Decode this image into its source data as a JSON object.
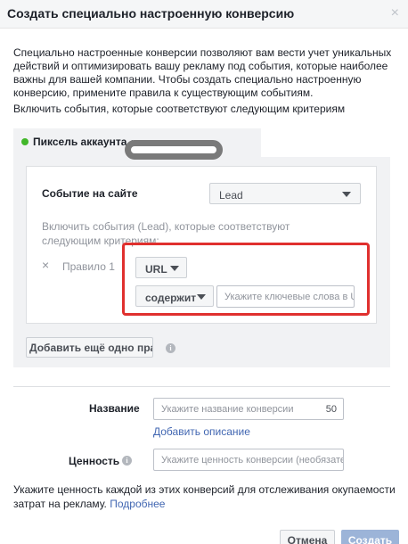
{
  "dialog": {
    "title": "Создать специально настроенную конверсию",
    "close_glyph": "×",
    "intro": "Специально настроенные конверсии позволяют вам вести учет уникальных действий и оптимизировать вашу рекламу под события, которые наиболее важны для вашей компании. Чтобы создать специально настроенную конверсию, примените правила к существующим событиям.",
    "include_label": "Включить события, которые соответствуют следующим критериям"
  },
  "pixel": {
    "tab_label": "Пиксель аккаунта «",
    "status_color": "#42b72a"
  },
  "rules": {
    "event_label": "Событие на сайте",
    "event_value": "Lead",
    "include_sub": "Включить события (Lead), которые соответствуют следующим критериям:",
    "rule_remove_glyph": "×",
    "rule_label": "Правило 1",
    "field_value": "URL",
    "condition_value": "содержит",
    "keyword_placeholder": "Укажите ключевые слова в URL",
    "add_rule_label": "Добавить ещё одно прав..."
  },
  "form": {
    "name_label": "Название",
    "name_placeholder": "Укажите название конверсии",
    "name_counter": "50",
    "add_description": "Добавить описание",
    "value_label": "Ценность",
    "value_placeholder": "Укажите ценность конверсии (необязательно)",
    "footer_note": "Укажите ценность каждой из этих конверсий для отслеживания окупаемости затрат на рекламу.",
    "learn_more": "Подробнее"
  },
  "buttons": {
    "cancel": "Отмена",
    "create": "Создать"
  },
  "icons": {
    "info": "i"
  },
  "colors": {
    "highlight": "#e0302e",
    "link": "#4267b2",
    "primary_disabled": "#9cb4d8"
  }
}
